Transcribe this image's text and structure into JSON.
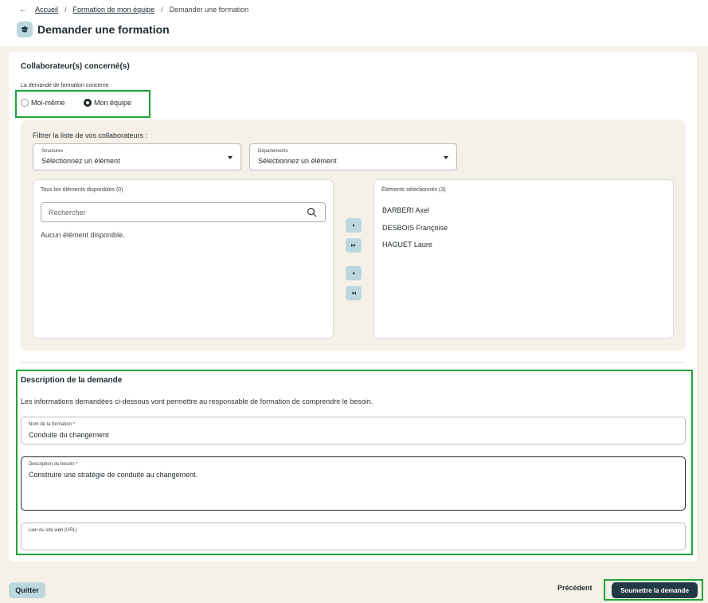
{
  "breadcrumb": {
    "back": "←",
    "items": [
      "Accueil",
      "Formation de mon équipe",
      "Demander une formation"
    ],
    "separator": "/"
  },
  "page": {
    "title": "Demander une formation",
    "icon": "graduation-cap-icon"
  },
  "collaborators": {
    "section_title": "Collaborateur(s) concerné(s)",
    "radio_label": "La demande de formation concerne",
    "options": [
      "Moi-même",
      "Mon équipe"
    ],
    "selected": "Mon équipe"
  },
  "filter": {
    "label": "Filtrer la liste de vos collaborateurs :",
    "structures": {
      "label": "Structures",
      "value": "Sélectionnez un élément"
    },
    "departements": {
      "label": "Départements",
      "value": "Sélectionnez un élément"
    }
  },
  "available": {
    "title": "Tous les éléments disponibles (0)",
    "search_placeholder": "Rechercher",
    "empty": "Aucun élément disponible."
  },
  "selected": {
    "title": "Éléments sélectionnés (3)",
    "items": [
      "BARBERI Axel",
      "DESBOIS Françoise",
      "HAGUET Laure"
    ]
  },
  "description": {
    "section_title": "Description de la demande",
    "info": "Les informations demandées ci-dessous vont permettre au responsable de formation de comprendre le besoin.",
    "name_field": {
      "label": "Nom de la formation *",
      "value": "Conduite du changement"
    },
    "need_field": {
      "label": "Description du besoin *",
      "value": "Construire une stratégie de conduite au changement."
    },
    "url_field": {
      "label": "Lien du site web (URL)",
      "value": ""
    }
  },
  "footer": {
    "quit": "Quitter",
    "previous": "Précédent",
    "submit": "Soumettre la demande"
  },
  "colors": {
    "accent": "#22a33a",
    "primary": "#1f3a44",
    "chip": "#bcd8de",
    "background": "#f5f1e8"
  }
}
